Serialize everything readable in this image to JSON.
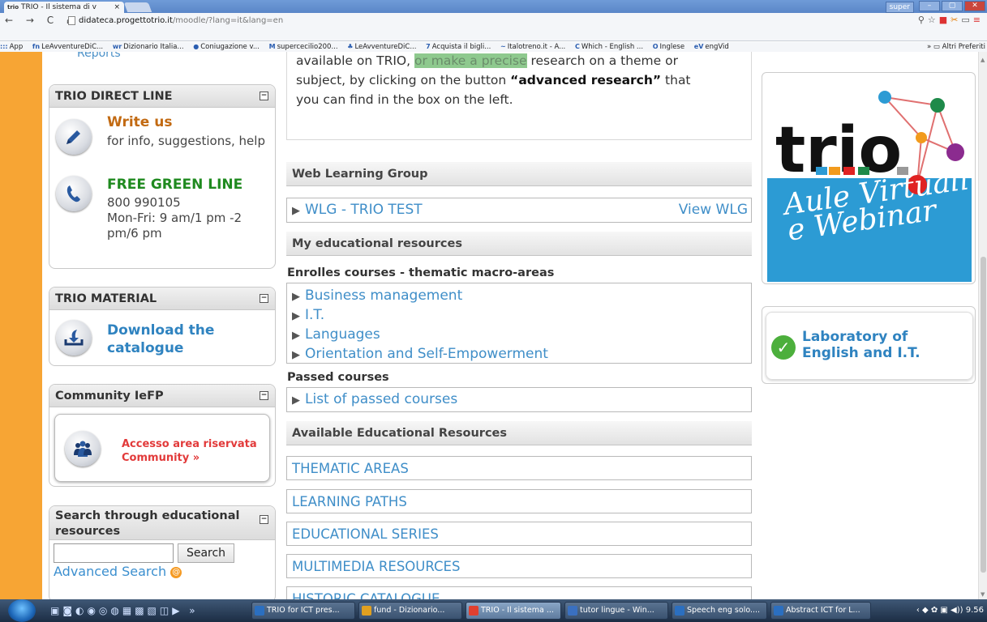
{
  "browser": {
    "tab_title": "TRIO - Il sistema di v",
    "tab_favicon": "trio",
    "tab_close": "×",
    "user_badge": "super",
    "address_host": "didateca.progettotrio.it",
    "address_path": "/moodle/?lang=it&lang=en",
    "nav_glyphs": "← → C ⌂",
    "bookmarks": [
      {
        "icon": "::: ",
        "label": "App"
      },
      {
        "icon": "fn",
        "label": "LeAvventureDiC..."
      },
      {
        "icon": "wr",
        "label": "Dizionario Italia..."
      },
      {
        "icon": "●",
        "label": "Coniugazione v..."
      },
      {
        "icon": "M",
        "label": "supercecilio200..."
      },
      {
        "icon": "♣",
        "label": "LeAvventureDiC..."
      },
      {
        "icon": "7",
        "label": "Acquista il bigli..."
      },
      {
        "icon": "~",
        "label": "Italotreno.it - A..."
      },
      {
        "icon": "C",
        "label": "Which - English ..."
      },
      {
        "icon": "O",
        "label": "Inglese"
      },
      {
        "icon": "eV",
        "label": "engVid"
      }
    ],
    "bookmarks_more": "» ",
    "bookmarks_other": "Altri Preferiti"
  },
  "sidebar": {
    "reports_label": "Reports",
    "direct_line": {
      "title": "TRIO DIRECT LINE",
      "write_title": "Write us",
      "write_desc": "for info, suggestions, help",
      "green_title": "FREE GREEN LINE",
      "green_number": "800 990105",
      "green_hours": "Mon-Fri: 9 am/1 pm -2 pm/6 pm"
    },
    "material": {
      "title": "TRIO MATERIAL",
      "download_label": "Download the catalogue"
    },
    "community": {
      "title": "Community IeFP",
      "link_line1": "Accesso area riservata",
      "link_line2": "Community »"
    },
    "search": {
      "title": "Search through educational resources",
      "input_value": "",
      "button_label": "Search",
      "advanced_label": "Advanced Search"
    },
    "collapse_glyph": "−"
  },
  "main": {
    "intro": {
      "line1_a": "available on TRIO, ",
      "line1_hl": "or make a precise",
      "line1_b": " research on a theme or",
      "line2_a": "subject, by clicking on the button ",
      "line2_bold": "“advanced research”",
      "line2_b": " that",
      "line3": "you can find in the box on the left."
    },
    "wlg_header": "Web Learning Group",
    "wlg_item": "WLG - TRIO TEST",
    "wlg_view": "View WLG",
    "my_resources_header": "My educational resources",
    "enrolled_header": "Enrolles courses - thematic macro-areas",
    "enrolled_courses": [
      "Business management",
      "I.T.",
      "Languages",
      "Orientation and Self-Empowerment"
    ],
    "passed_header": "Passed courses",
    "passed_link": "List of passed courses",
    "available_header": "Available Educational Resources",
    "resources": [
      "THEMATIC AREAS",
      "LEARNING PATHS",
      "EDUCATIONAL SERIES",
      "MULTIMEDIA RESOURCES",
      "HISTORIC CATALOGUE"
    ]
  },
  "right": {
    "promo_brand": "trio",
    "promo_script": "Aule Virtuali e Webinar",
    "lab_label": "Laboratory of English and I.T."
  },
  "taskbar": {
    "tasks": [
      {
        "label": "TRIO for ICT pres...",
        "icon_color": "#2b6fc0"
      },
      {
        "label": "fund - Dizionario...",
        "icon_color": "#e0a020"
      },
      {
        "label": "TRIO - Il sistema ...",
        "icon_color": "#e04030"
      },
      {
        "label": "tutor lingue - Win...",
        "icon_color": "#3a70c0"
      },
      {
        "label": "Speech eng solo....",
        "icon_color": "#2b6fc0"
      },
      {
        "label": "Abstract ICT for L...",
        "icon_color": "#2b6fc0"
      }
    ],
    "clock": "9.56"
  }
}
